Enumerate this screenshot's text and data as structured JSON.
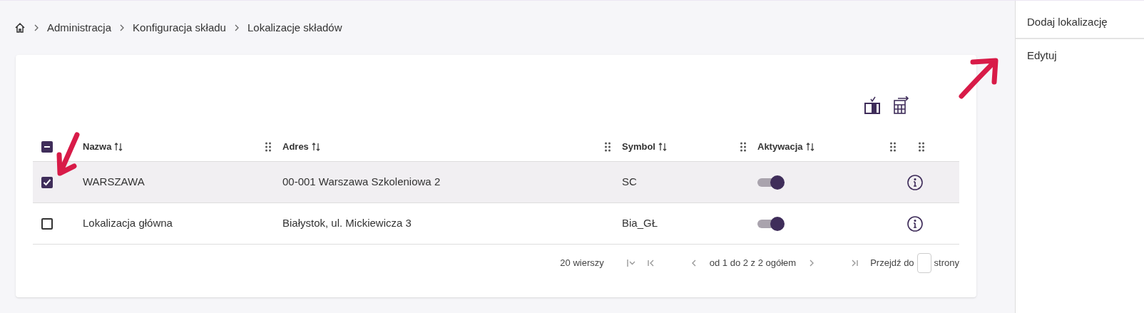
{
  "breadcrumb": [
    "Administracja",
    "Konfiguracja składu",
    "Lokalizacje składów"
  ],
  "table": {
    "all_rows_checkbox": {
      "indeterminate": true
    },
    "columns": [
      {
        "label": "Nazwa"
      },
      {
        "label": "Adres"
      },
      {
        "label": "Symbol"
      },
      {
        "label": "Aktywacja"
      }
    ],
    "rows": [
      {
        "selected": true,
        "cells": [
          "WARSZAWA",
          "00-001 Warszawa Szkoleniowa 2",
          "SC"
        ],
        "active": true
      },
      {
        "selected": false,
        "cells": [
          "Lokalizacja główna",
          "Białystok, ul. Mickiewicza 3",
          "Bia_GŁ"
        ],
        "active": true
      }
    ]
  },
  "pagination": {
    "rows_per_page": "20 wierszy",
    "range": "od 1 do 2 z 2 ogółem",
    "goto_label": "Przejdź do",
    "goto_suffix": "strony"
  },
  "actions": [
    "Dodaj lokalizację",
    "Edytuj"
  ]
}
